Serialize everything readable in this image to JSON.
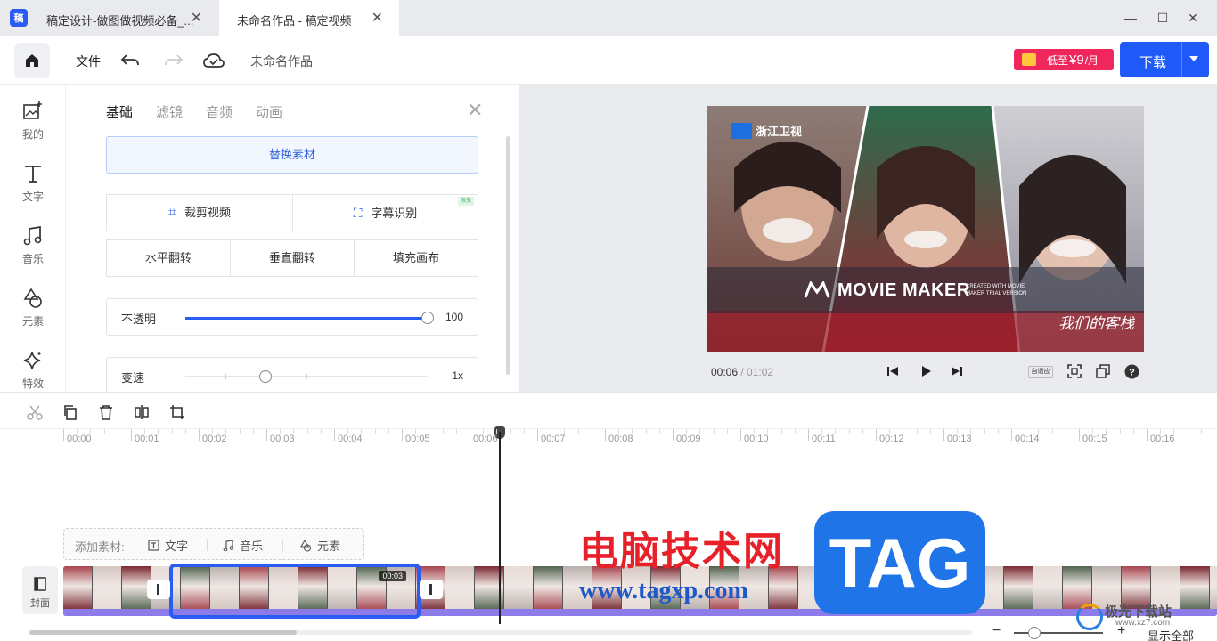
{
  "window": {
    "app_logo_text": "稿",
    "tabs": [
      {
        "label": "稿定设计-做图做视频必备_..."
      },
      {
        "label": "未命名作品 - 稿定视频"
      }
    ]
  },
  "toolbar": {
    "file_label": "文件",
    "doc_title": "未命名作品",
    "promo_prefix": "低至",
    "promo_price": "¥9",
    "promo_suffix": "/月",
    "download_label": "下载"
  },
  "sidebar": {
    "items": [
      {
        "label": "我的",
        "icon": "image-add-icon"
      },
      {
        "label": "文字",
        "icon": "text-icon"
      },
      {
        "label": "音乐",
        "icon": "music-icon"
      },
      {
        "label": "元素",
        "icon": "shapes-icon"
      },
      {
        "label": "特效",
        "icon": "sparkle-icon"
      }
    ]
  },
  "panel": {
    "tabs": [
      "基础",
      "滤镜",
      "音频",
      "动画"
    ],
    "active_tab": 0,
    "replace_label": "替换素材",
    "crop_label": "裁剪视频",
    "subtitle_label": "字幕识别",
    "new_badge": "限免",
    "flip_h_label": "水平翻转",
    "flip_v_label": "垂直翻转",
    "fill_label": "填充画布",
    "opacity_label": "不透明",
    "opacity_value": "100",
    "opacity_level": 1.0,
    "speed_label": "变速",
    "speed_value": "1x",
    "speed_level": 0.33
  },
  "preview": {
    "channel_text": "浙江卫视",
    "watermark_text": "MOVIE MAKER",
    "watermark_small": "CREATED WITH MOVIE MAKER TRIAL VERSION",
    "show_logo": "我们的客栈",
    "time_current": "00:06",
    "time_total": "/ 01:02",
    "fit_label": "自适应"
  },
  "timeline": {
    "ruler_labels": [
      "00:00",
      "00:01",
      "00:02",
      "00:03",
      "00:04",
      "00:05",
      "00:06",
      "00:07",
      "00:08",
      "00:09",
      "00:10",
      "00:11",
      "00:12",
      "00:13",
      "00:14",
      "00:15",
      "00:16"
    ],
    "add_label": "添加素材:",
    "add_text": "文字",
    "add_music": "音乐",
    "add_element": "元素",
    "cover_label": "封面",
    "clip_time": "00:03",
    "show_all": "显示全部"
  },
  "overlay": {
    "site_cn": "电脑技术网",
    "site_url": "www.tagxp.com",
    "tag": "TAG",
    "dl_site": "极光下载站",
    "dl_site_sub": "www.xz7.com"
  },
  "colors": {
    "accent": "#1f5af8",
    "promo": "#f0275c",
    "track_base": "#8c7be8"
  }
}
